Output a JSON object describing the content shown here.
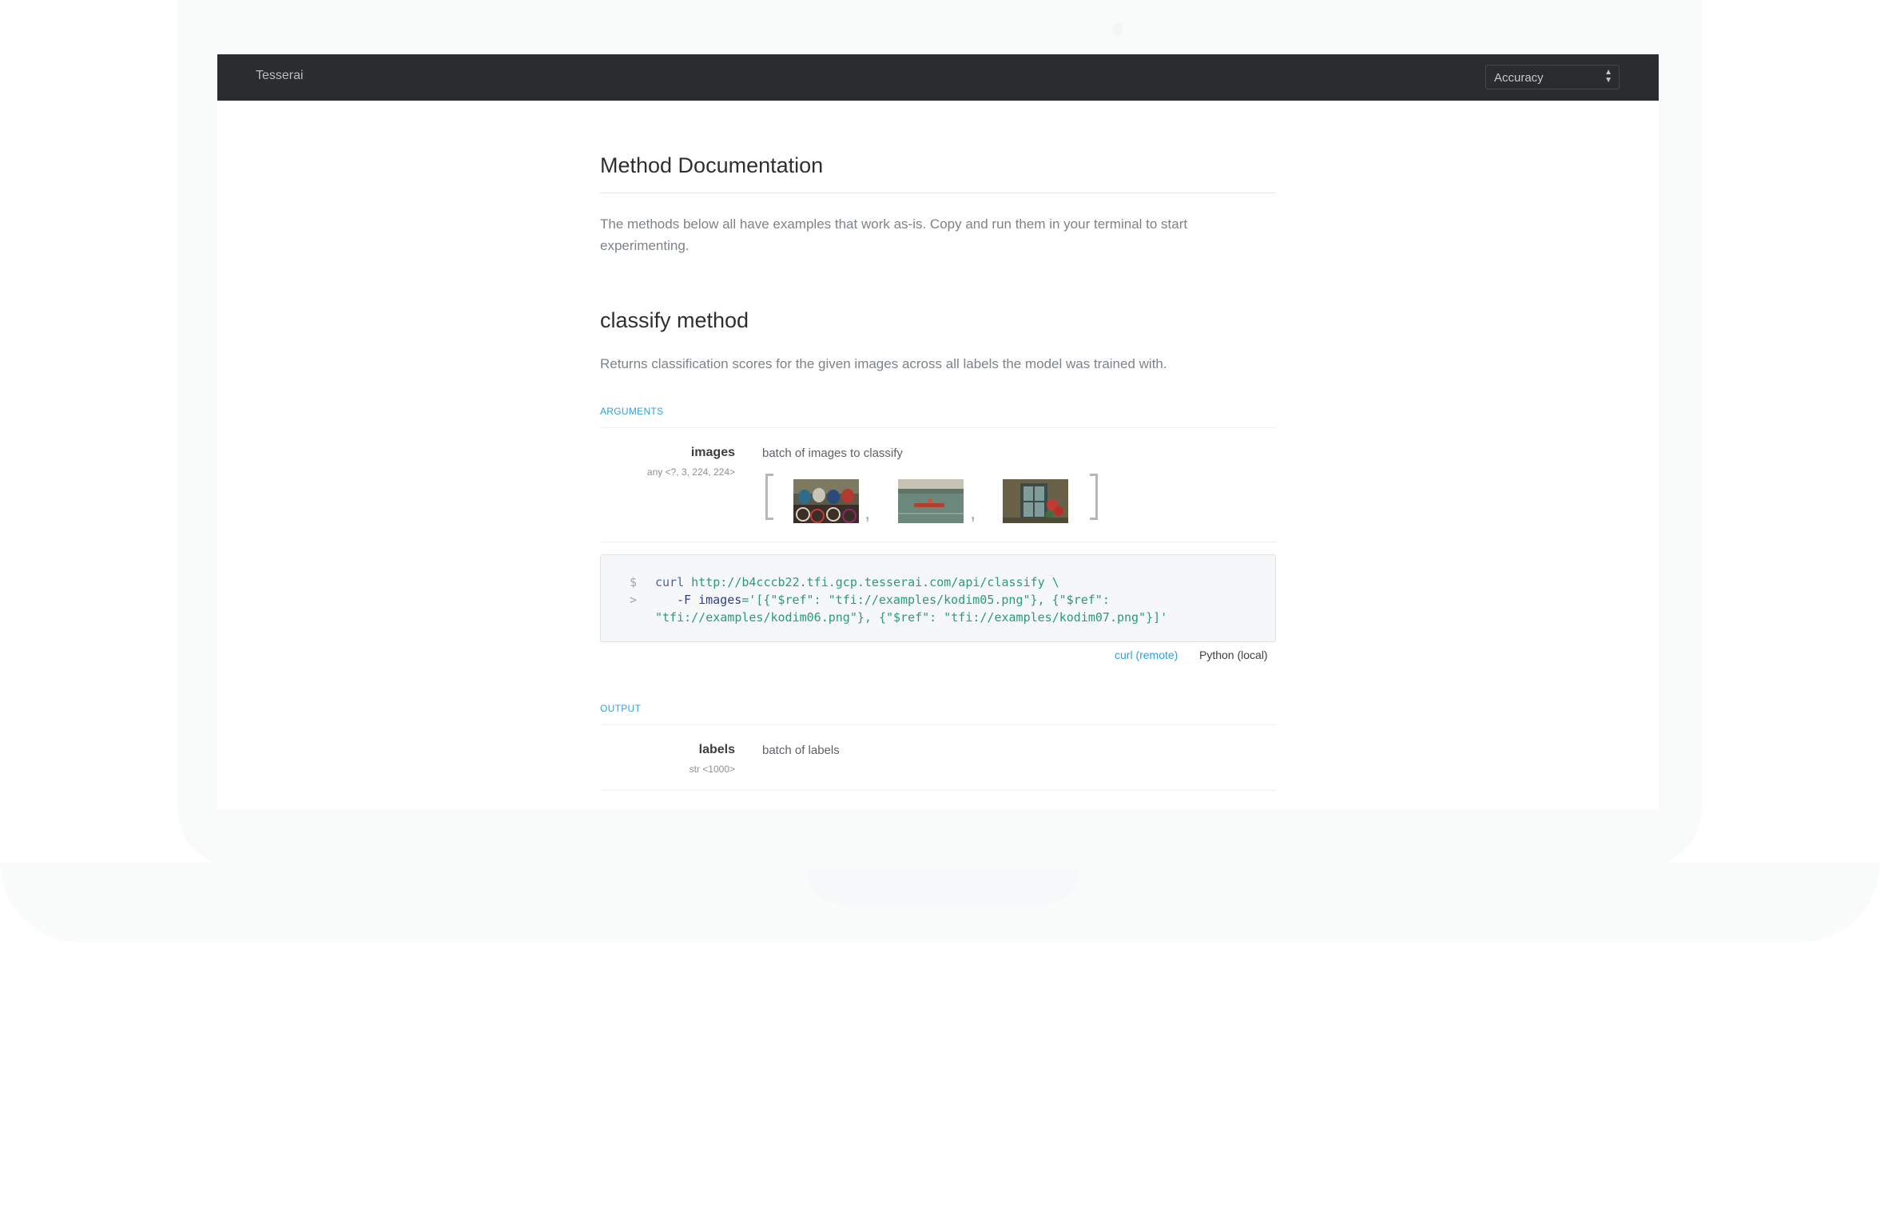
{
  "app": {
    "brand": "Tesserai",
    "model_select": {
      "value": "Accuracy"
    }
  },
  "page": {
    "title": "Method Documentation",
    "intro": "The methods below all have examples that work as-is. Copy and run them in your terminal to start experimenting."
  },
  "method": {
    "title": "classify method",
    "description": "Returns classification scores for the given images across all labels the model was trained with.",
    "arguments_label": "ARGUMENTS",
    "argument": {
      "name": "images",
      "type": "any <?, 3, 224, 224>",
      "description": "batch of images to classify",
      "separators": [
        ",",
        ","
      ]
    },
    "code": {
      "prompts": [
        "$",
        ">"
      ],
      "line1_cmd": "curl",
      "line1_url": " http://b4cccb22.tfi.gcp.tesserai.com/api/classify \\",
      "line2_flag": "-F",
      "line2_key": " images",
      "line2_val": "='[{\"$ref\": \"tfi://examples/kodim05.png\"}, {\"$ref\":",
      "line3": "\"tfi://examples/kodim06.png\"}, {\"$ref\": \"tfi://examples/kodim07.png\"}]'"
    },
    "tabs": [
      "curl (remote)",
      "Python (local)"
    ],
    "output_label": "OUTPUT",
    "output": {
      "name": "labels",
      "type": "str <1000>",
      "description": "batch of labels"
    }
  }
}
